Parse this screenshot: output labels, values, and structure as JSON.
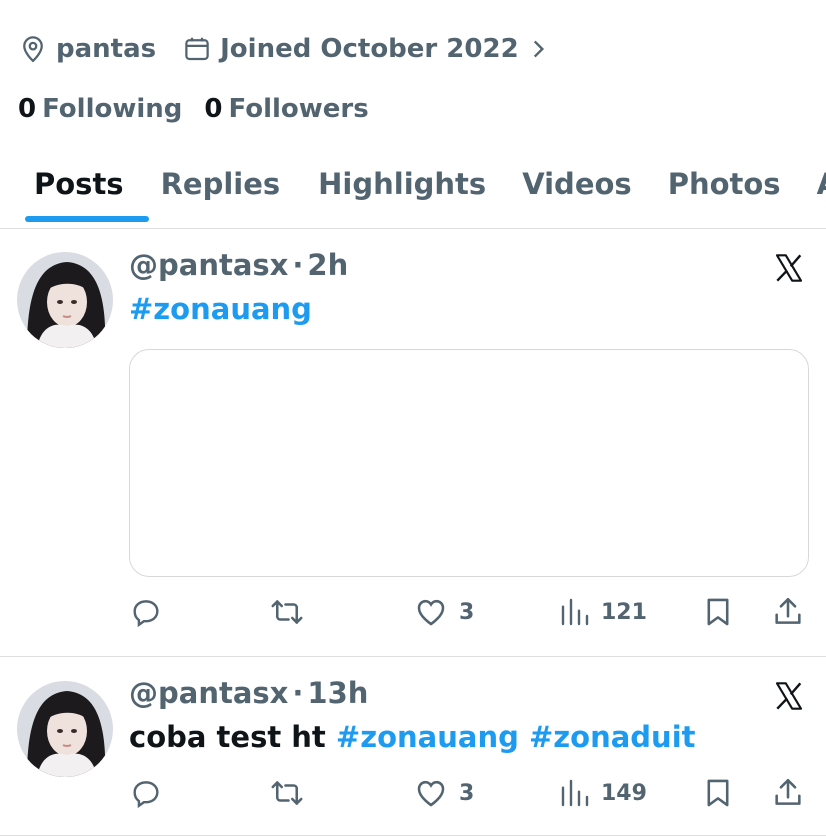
{
  "profile": {
    "location": "pantas",
    "joined": "Joined October 2022",
    "following_count": "0",
    "following_label": "Following",
    "followers_count": "0",
    "followers_label": "Followers"
  },
  "tabs": [
    {
      "label": "Posts",
      "active": true
    },
    {
      "label": "Replies"
    },
    {
      "label": "Highlights"
    },
    {
      "label": "Videos"
    },
    {
      "label": "Photos"
    },
    {
      "label": "Ar"
    }
  ],
  "posts": [
    {
      "handle": "@pantasx",
      "separator": "·",
      "time": "2h",
      "text": "",
      "hashtags": [
        "#zonauang"
      ],
      "likes": "3",
      "views": "121"
    },
    {
      "handle": "@pantasx",
      "separator": "·",
      "time": "13h",
      "text": "coba test ht",
      "hashtags": [
        "#zonauang",
        "#zonaduit"
      ],
      "likes": "3",
      "views": "149"
    }
  ],
  "colors": {
    "accent": "#1d9bf0",
    "text": "#0f1419",
    "secondary": "#536471",
    "border": "#dcdfe2"
  },
  "icons": [
    "location-pin-icon",
    "calendar-icon",
    "chevron-right-icon",
    "x-logo-icon",
    "reply-icon",
    "repost-icon",
    "like-icon",
    "views-icon",
    "bookmark-icon",
    "share-icon"
  ]
}
